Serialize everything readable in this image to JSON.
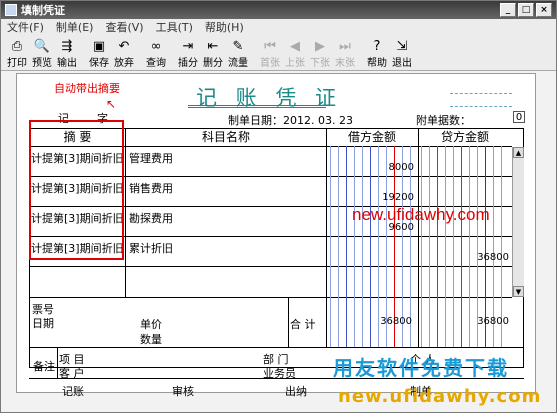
{
  "window": {
    "title": "填制凭证",
    "min": "_",
    "max": "□",
    "close": "×"
  },
  "menu": [
    "文件(F)",
    "制单(E)",
    "查看(V)",
    "工具(T)",
    "帮助(H)"
  ],
  "toolbar": [
    {
      "label": "打印",
      "icon": "printer-icon",
      "glyph": "⎙",
      "enabled": true
    },
    {
      "label": "预览",
      "icon": "preview-icon",
      "glyph": "🔍",
      "enabled": true
    },
    {
      "label": "输出",
      "icon": "export-icon",
      "glyph": "⇶",
      "enabled": true
    },
    {
      "label": "保存",
      "icon": "save-icon",
      "glyph": "▣",
      "enabled": true
    },
    {
      "label": "放弃",
      "icon": "undo-icon",
      "glyph": "↶",
      "enabled": true
    },
    {
      "label": "查询",
      "icon": "binoculars-icon",
      "glyph": "∞",
      "enabled": true
    },
    {
      "label": "插分",
      "icon": "insert-row-icon",
      "glyph": "⇥",
      "enabled": true
    },
    {
      "label": "删分",
      "icon": "delete-row-icon",
      "glyph": "⇤",
      "enabled": true
    },
    {
      "label": "流量",
      "icon": "flow-icon",
      "glyph": "✎",
      "enabled": true
    },
    {
      "label": "首张",
      "icon": "first-icon",
      "glyph": "⏮",
      "enabled": false
    },
    {
      "label": "上张",
      "icon": "prev-icon",
      "glyph": "◀",
      "enabled": false
    },
    {
      "label": "下张",
      "icon": "next-icon",
      "glyph": "▶",
      "enabled": false
    },
    {
      "label": "末张",
      "icon": "last-icon",
      "glyph": "⏭",
      "enabled": false
    },
    {
      "label": "帮助",
      "icon": "help-icon",
      "glyph": "?",
      "enabled": true
    },
    {
      "label": "退出",
      "icon": "exit-icon",
      "glyph": "⇲",
      "enabled": true
    }
  ],
  "annotation": "自动带出摘要",
  "voucher": {
    "title": "记 账 凭 证",
    "word_label": "记",
    "word_suffix": "字",
    "date": "制单日期：2012. 03. 23",
    "attach_label": "附单据数：",
    "attach_count": "0",
    "headers": {
      "summary": "摘 要",
      "account": "科目名称",
      "debit": "借方金额",
      "credit": "贷方金额"
    },
    "rows": [
      {
        "summary": "计提第[3]期间折旧",
        "account": "管理费用",
        "debit": "8000",
        "credit": ""
      },
      {
        "summary": "计提第[3]期间折旧",
        "account": "销售费用",
        "debit": "19200",
        "credit": ""
      },
      {
        "summary": "计提第[3]期间折旧",
        "account": "勘探费用",
        "debit": "9600",
        "credit": ""
      },
      {
        "summary": "计提第[3]期间折旧",
        "account": "累计折旧",
        "debit": "",
        "credit": "36800"
      }
    ],
    "ticket_no": "票号",
    "date_label": "日期",
    "unit_price": "单价",
    "quantity": "数量",
    "total_label": "合 计",
    "total_debit": "36800",
    "total_credit": "36800",
    "remarks": "备注",
    "project": "项  目",
    "customer": "客  户",
    "department": "部  门",
    "person": "个  人",
    "salesman": "业务员",
    "bookkeep": "记账",
    "audit": "审核",
    "cashier": "出纳",
    "maker": "制单"
  },
  "watermarks": {
    "red": "new.ufidawhy.com",
    "blue": "用友软件免费下载",
    "gold": "new.ufidawhy.com"
  },
  "colors": {
    "title_teal": "#1a8a8a",
    "annotation_red": "#e00000"
  }
}
